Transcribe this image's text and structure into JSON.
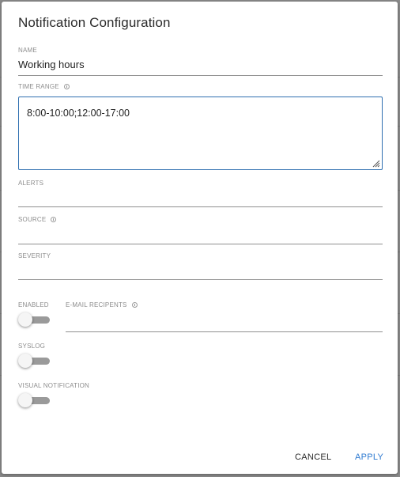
{
  "dialog": {
    "title": "Notification Configuration"
  },
  "fields": {
    "name": {
      "label": "NAME",
      "value": "Working hours"
    },
    "time_range": {
      "label": "TIME RANGE",
      "value": "8:00-10:00;12:00-17:00"
    },
    "alerts": {
      "label": "ALERTS",
      "value": ""
    },
    "source": {
      "label": "SOURCE",
      "value": ""
    },
    "severity": {
      "label": "SEVERITY",
      "value": ""
    },
    "email_recipients": {
      "label": "E-MAIL RECIPENTS",
      "value": ""
    }
  },
  "toggles": {
    "enabled": {
      "label": "ENABLED",
      "on": false
    },
    "syslog": {
      "label": "SYSLOG",
      "on": false
    },
    "visual_notification": {
      "label": "VISUAL NOTIFICATION",
      "on": false
    }
  },
  "actions": {
    "cancel_label": "CANCEL",
    "apply_label": "APPLY"
  },
  "colors": {
    "accent": "#2f6fb0",
    "apply_text": "#2f7bd1",
    "cancel_text": "#2b2b2b",
    "toggle_track": "#9a9a9a",
    "backdrop": "#8a8a8a"
  },
  "icons": {
    "info": "info-icon",
    "resize": "resize-grip-icon"
  }
}
